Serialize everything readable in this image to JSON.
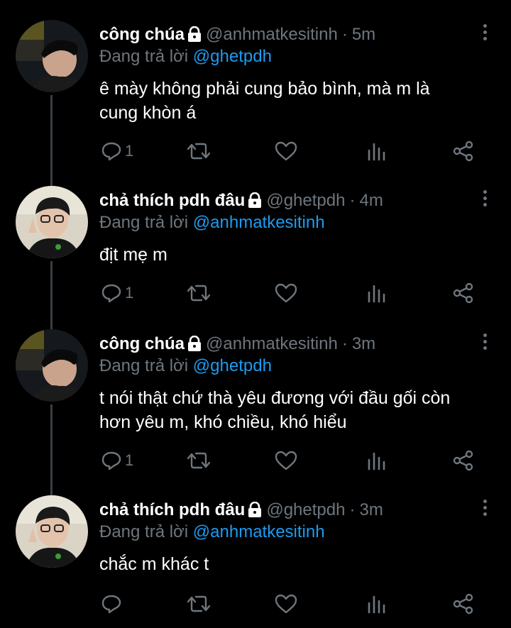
{
  "tweets": [
    {
      "name": "công chúa",
      "handle": "@anhmatkesitinh",
      "time": "5m",
      "replying_prefix": "Đang trả lời",
      "replying_to": "@ghetpdh",
      "text_lines": [
        "ê mày không phải cung bảo bình, mà m là",
        "cung khòn á"
      ],
      "reply_count": "1"
    },
    {
      "name": "chả thích pdh đâu",
      "handle": "@ghetpdh",
      "time": "4m",
      "replying_prefix": "Đang trả lời",
      "replying_to": "@anhmatkesitinh",
      "text_lines": [
        "địt mẹ m"
      ],
      "reply_count": "1"
    },
    {
      "name": "công chúa",
      "handle": "@anhmatkesitinh",
      "time": "3m",
      "replying_prefix": "Đang trả lời",
      "replying_to": "@ghetpdh",
      "text_lines": [
        "t nói thật chứ thà yêu đương với đầu gối còn",
        "hơn yêu m, khó chiều, khó hiểu"
      ],
      "reply_count": "1"
    },
    {
      "name": "chả thích pdh đâu",
      "handle": "@ghetpdh",
      "time": "3m",
      "replying_prefix": "Đang trả lời",
      "replying_to": "@anhmatkesitinh",
      "text_lines": [
        "chắc m khác t"
      ],
      "reply_count": ""
    }
  ],
  "separator": "·",
  "icons": {
    "lock": "lock-icon",
    "more": "more-vertical-icon",
    "reply": "reply-icon",
    "retweet": "retweet-icon",
    "like": "heart-icon",
    "analytics": "analytics-icon",
    "share": "share-icon"
  },
  "colors": {
    "background": "#000000",
    "muted": "#6e767d",
    "link": "#1d9bf0",
    "thread_line": "#3a3f44"
  }
}
